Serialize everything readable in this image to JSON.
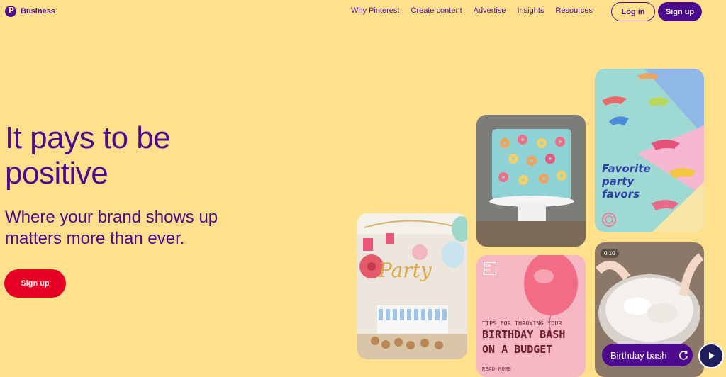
{
  "header": {
    "brand": "Business",
    "nav": [
      "Why Pinterest",
      "Create content",
      "Advertise",
      "Insights",
      "Resources"
    ],
    "login_label": "Log in",
    "signup_label": "Sign up"
  },
  "hero": {
    "title": "It pays to be positive",
    "subtitle": "Where your brand shows up matters more than ever.",
    "cta_label": "Sign up"
  },
  "cards": {
    "budget": {
      "logo": "MUM MEE",
      "small": "TIPS FOR THROWING YOUR",
      "big_line1": "BIRTHDAY BASH",
      "big_line2": "ON A BUDGET",
      "more": "READ MORE"
    },
    "dino": {
      "line1": "Favorite",
      "line2": "party",
      "line3": "favors"
    },
    "video": {
      "time": "0:10",
      "label": "Birthday bash"
    }
  },
  "colors": {
    "background": "#FFE08C",
    "brand_purple": "#4E0A8F",
    "cta_red": "#E60023"
  }
}
